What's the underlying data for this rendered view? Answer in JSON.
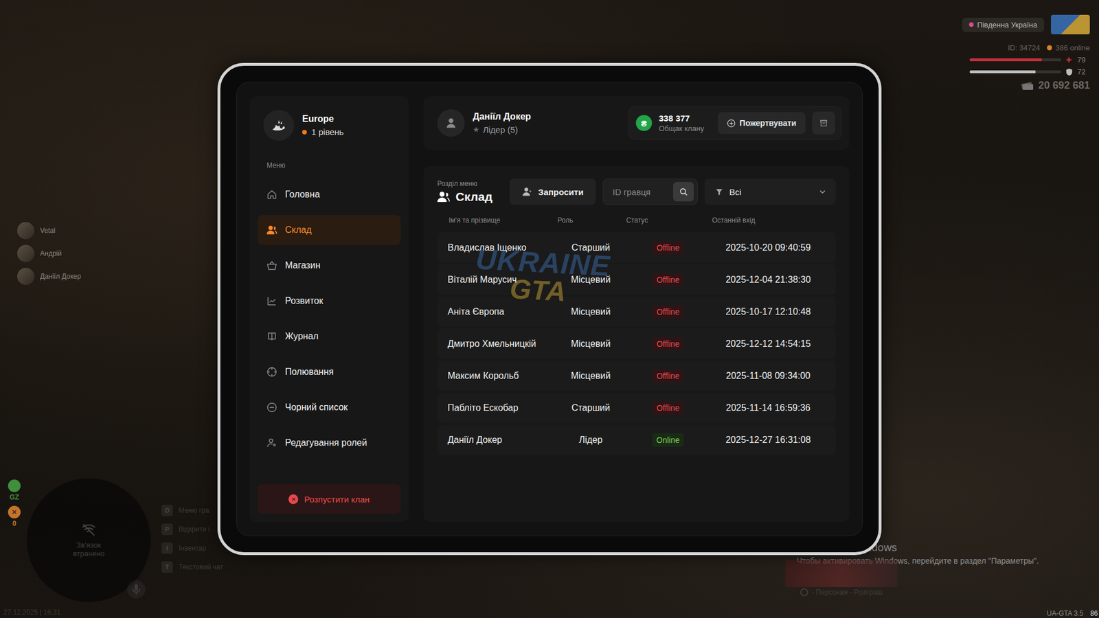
{
  "hud": {
    "server": "Південна Україна",
    "id": "ID: 34724",
    "online": "386 online",
    "health": {
      "reading": "79",
      "level": 0.79
    },
    "armor": {
      "reading": "72",
      "level": 0.72
    },
    "money": "20 692 681"
  },
  "voice": [
    {
      "name": "Vetal"
    },
    {
      "name": "Андрій"
    },
    {
      "name": "Даніїл Докер"
    }
  ],
  "status": {
    "zone": "GZ",
    "count": "0"
  },
  "minimap": {
    "text": "Зв'язок втрачено"
  },
  "hints": [
    {
      "key": "O",
      "label": "Меню гра"
    },
    {
      "key": "P",
      "label": "Відкрити і"
    },
    {
      "key": "I",
      "label": "Інвентар"
    },
    {
      "key": "T",
      "label": "Текстовий чат"
    }
  ],
  "datetime": "27.12.2025 | 16:31",
  "windows_activation": {
    "title": "Активация Windows",
    "text": "Чтобы активировать Windows, перейдите в раздел \"Параметры\"."
  },
  "giveaway": {
    "caption": "- Персонаж - Розіграш"
  },
  "version": "UA-GTA 3.5",
  "fps": "86",
  "clan": {
    "name": "Europe",
    "level": "1 рівень"
  },
  "menu_heading": "Меню",
  "menu": [
    {
      "label": "Головна",
      "selected": false
    },
    {
      "label": "Склад",
      "selected": true
    },
    {
      "label": "Магазин",
      "selected": false
    },
    {
      "label": "Розвиток",
      "selected": false
    },
    {
      "label": "Журнал",
      "selected": false
    },
    {
      "label": "Полювання",
      "selected": false
    },
    {
      "label": "Чорний список",
      "selected": false
    },
    {
      "label": "Редагування ролей",
      "selected": false
    }
  ],
  "dissolve_button": "Розпустити клан",
  "user": {
    "name": "Даніїл Докер",
    "role": "Лідер (5)"
  },
  "treasury": {
    "currency": "₴",
    "amount": "338 377",
    "label": "Общак клану"
  },
  "donate_button": "Пожертвувати",
  "section": {
    "caption": "Розділ меню",
    "title": "Склад"
  },
  "invite_button": "Запросити",
  "search": {
    "placeholder": "ID гравця"
  },
  "filter": {
    "value": "Всі"
  },
  "watermark": [
    "UKRAINE",
    "GTA"
  ],
  "table": {
    "columns": [
      "Ім'я та прізвище",
      "Роль",
      "Статус",
      "Останній вхід"
    ],
    "rows": [
      {
        "name": "Владислав Іщенко",
        "role": "Старший",
        "status": "Offline",
        "online": false,
        "last_login": "2025-10-20 09:40:59"
      },
      {
        "name": "Віталій Марусич",
        "role": "Місцевий",
        "status": "Offline",
        "online": false,
        "last_login": "2025-12-04 21:38:30"
      },
      {
        "name": "Аніта Європа",
        "role": "Місцевий",
        "status": "Offline",
        "online": false,
        "last_login": "2025-10-17 12:10:48"
      },
      {
        "name": "Дмитро Хмельницкій",
        "role": "Місцевий",
        "status": "Offline",
        "online": false,
        "last_login": "2025-12-12 14:54:15"
      },
      {
        "name": "Максим Корольб",
        "role": "Місцевий",
        "status": "Offline",
        "online": false,
        "last_login": "2025-11-08 09:34:00"
      },
      {
        "name": "Пабліто Ескобар",
        "role": "Старший",
        "status": "Offline",
        "online": false,
        "last_login": "2025-11-14 16:59:36"
      },
      {
        "name": "Даніїл Докер",
        "role": "Лідер",
        "status": "Online",
        "online": true,
        "last_login": "2025-12-27 16:31:08"
      }
    ]
  }
}
